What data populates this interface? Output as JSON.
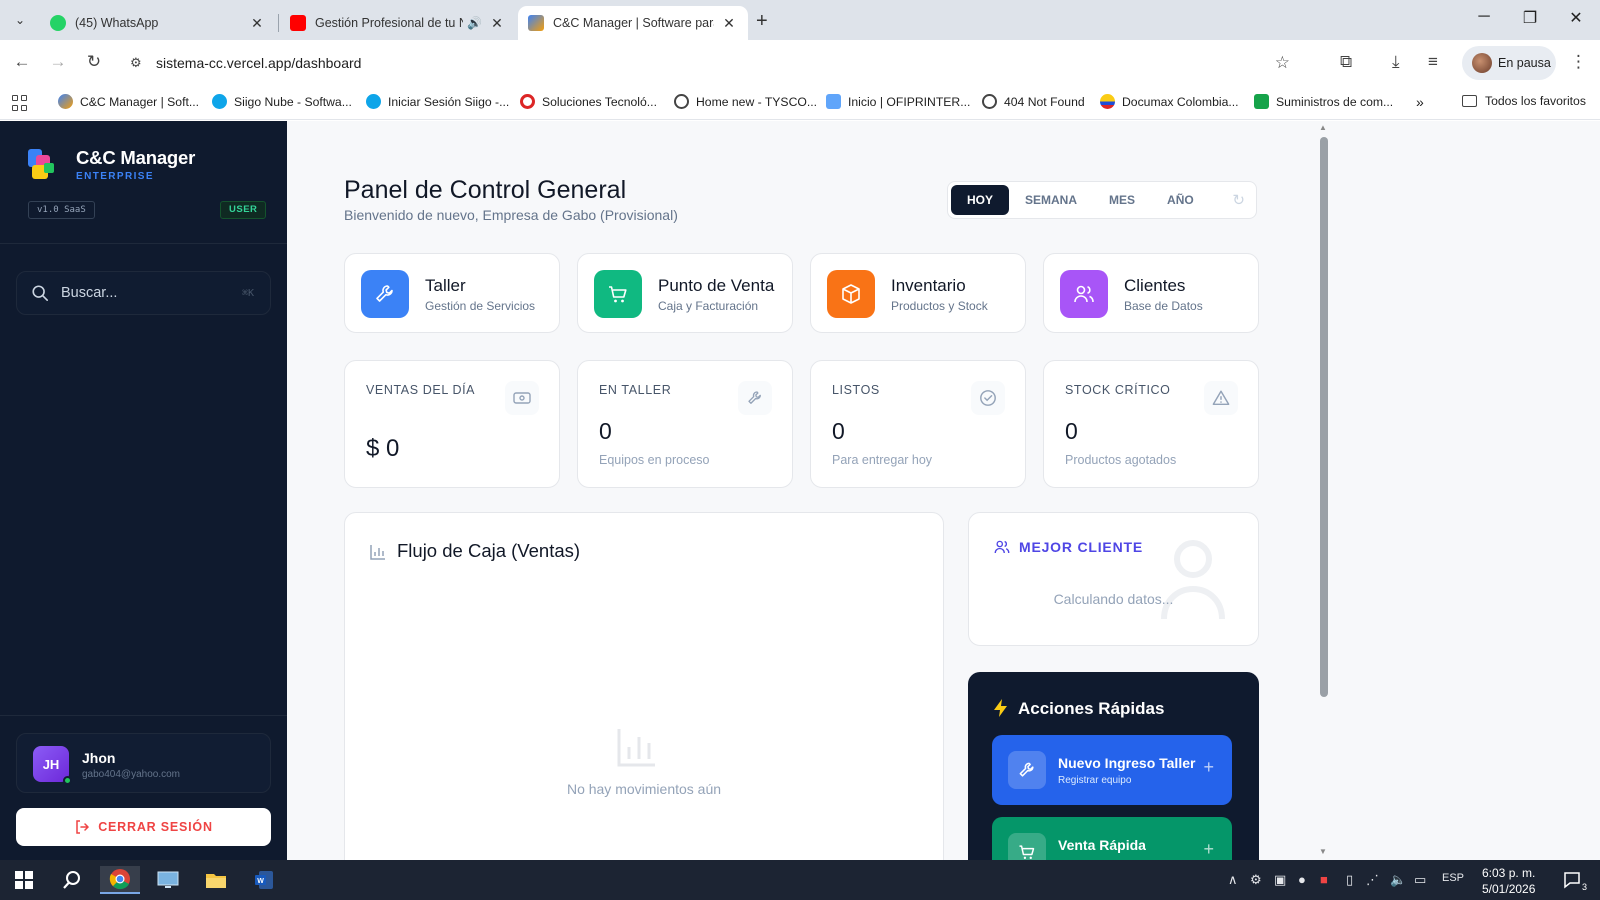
{
  "browser": {
    "tabs": [
      {
        "title": "(45) WhatsApp",
        "favicon_color": "#25d366"
      },
      {
        "title": "Gestión Profesional de tu N",
        "favicon_color": "#ff0000"
      },
      {
        "title": "C&C Manager | Software para T",
        "favicon_color": "#3b82f6"
      }
    ],
    "url": "sistema-cc.vercel.app/dashboard",
    "profile_label": "En pausa",
    "bookmarks": [
      "C&C Manager | Soft...",
      "Siigo Nube - Softwa...",
      "Iniciar Sesión Siigo -...",
      "Soluciones Tecnoló...",
      "Home new - TYSCO...",
      "Inicio | OFIPRINTER...",
      "404 Not Found",
      "Documax Colombia...",
      "Suministros de com..."
    ],
    "all_bookmarks_label": "Todos los favoritos"
  },
  "sidebar": {
    "brand_name": "C&C Manager",
    "brand_sub": "ENTERPRISE",
    "version": "v1.0 SaaS",
    "role": "USER",
    "search_placeholder": "Buscar...",
    "search_shortcut": "⌘K",
    "user": {
      "initials": "JH",
      "name": "Jhon",
      "email": "gabo404@yahoo.com"
    },
    "logout_label": "CERRAR SESIÓN"
  },
  "header": {
    "title": "Panel de Control General",
    "subtitle": "Bienvenido de nuevo, Empresa de Gabo (Provisional)",
    "ranges": [
      "HOY",
      "SEMANA",
      "MES",
      "AÑO"
    ],
    "active_range": "HOY"
  },
  "modules": [
    {
      "title": "Taller",
      "subtitle": "Gestión de Servicios",
      "color": "#3b82f6",
      "icon": "wrench-icon"
    },
    {
      "title": "Punto de Venta",
      "subtitle": "Caja y Facturación",
      "color": "#10b981",
      "icon": "cart-icon"
    },
    {
      "title": "Inventario",
      "subtitle": "Productos y Stock",
      "color": "#f97316",
      "icon": "box-icon"
    },
    {
      "title": "Clientes",
      "subtitle": "Base de Datos",
      "color": "#a855f7",
      "icon": "users-icon"
    }
  ],
  "stats": [
    {
      "label": "VENTAS DEL DÍA",
      "value": "$ 0",
      "desc": "",
      "icon": "cash-icon"
    },
    {
      "label": "EN TALLER",
      "value": "0",
      "desc": "Equipos en proceso",
      "icon": "wrench-icon"
    },
    {
      "label": "LISTOS",
      "value": "0",
      "desc": "Para entregar hoy",
      "icon": "check-circle-icon"
    },
    {
      "label": "STOCK CRÍTICO",
      "value": "0",
      "desc": "Productos agotados",
      "icon": "warning-icon"
    }
  ],
  "cash_flow": {
    "title": "Flujo de Caja (Ventas)",
    "empty_text": "No hay movimientos aún"
  },
  "best_client": {
    "title": "MEJOR CLIENTE",
    "status": "Calculando datos..."
  },
  "quick_actions": {
    "title": "Acciones Rápidas",
    "items": [
      {
        "title": "Nuevo Ingreso Taller",
        "subtitle": "Registrar equipo",
        "color": "#2563eb"
      },
      {
        "title": "Venta Rápida",
        "subtitle": "",
        "color": "#059669"
      }
    ]
  },
  "taskbar": {
    "language": "ESP",
    "time": "6:03 p. m.",
    "date": "5/01/2026",
    "notifications": "3"
  }
}
